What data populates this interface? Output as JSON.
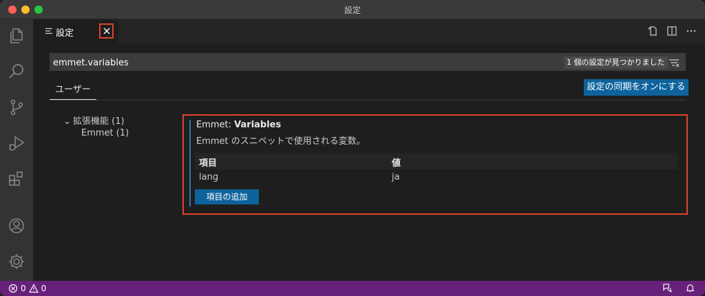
{
  "window": {
    "title": "設定"
  },
  "tab": {
    "label": "設定"
  },
  "search": {
    "value": "emmet.variables",
    "result_count": "1 個の設定が見つかりました"
  },
  "scope": {
    "user_tab": "ユーザー"
  },
  "sync_button": "設定の同期をオンにする",
  "toc": {
    "extensions": "拡張機能 (1)",
    "emmet": "Emmet (1)"
  },
  "setting": {
    "title_prefix": "Emmet: ",
    "title_name": "Variables",
    "description": "Emmet のスニペットで使用される変数。",
    "columns": {
      "key": "項目",
      "value": "値"
    },
    "rows": [
      {
        "key": "lang",
        "value": "ja"
      }
    ],
    "add_button": "項目の追加"
  },
  "status": {
    "errors": "0",
    "warnings": "0"
  },
  "colors": {
    "accent_blue": "#0e639c",
    "highlight_red": "#e0442c",
    "statusbar_purple": "#68217a"
  }
}
